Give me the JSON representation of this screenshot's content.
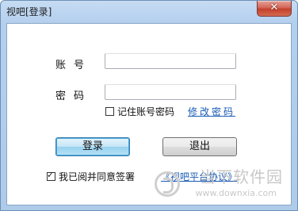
{
  "window": {
    "title": "视吧[登录]",
    "close_glyph": "✕"
  },
  "form": {
    "account_label": "账号",
    "account_value": "",
    "password_label": "密码",
    "password_value": "",
    "remember_label": "记住账号密码",
    "remember_checked": false,
    "change_password_link": "修改密码",
    "login_button": "登录",
    "exit_button": "退出",
    "agree_label": "我已阅并同意签署",
    "agree_checked": true,
    "agreement_link": "《视吧平台协议》"
  },
  "watermark": {
    "name": "当下软件园",
    "url": "www.downxia.com"
  },
  "colors": {
    "link": "#1a5bb5",
    "title_bar": "#b4cfee",
    "close_button": "#c3402d"
  }
}
